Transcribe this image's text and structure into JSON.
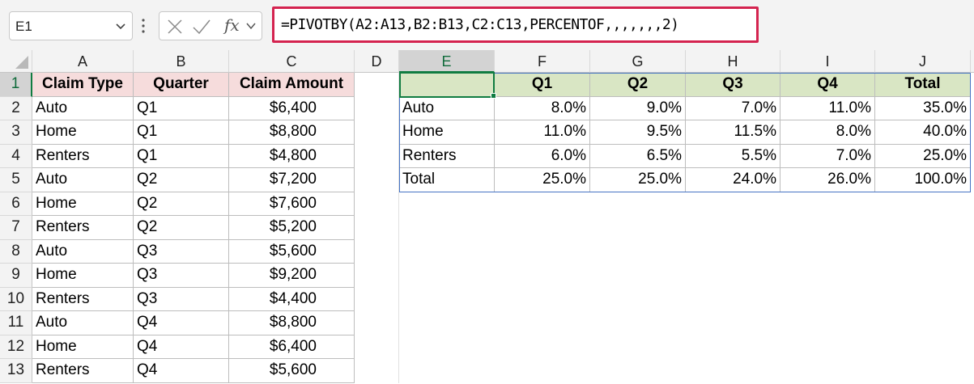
{
  "formula_bar": {
    "name_box": "E1",
    "fx_label": "fx",
    "formula": "=PIVOTBY(A2:A13,B2:B13,C2:C13,PERCENTOF,,,,,,,2)"
  },
  "columns": [
    "A",
    "B",
    "C",
    "D",
    "E",
    "F",
    "G",
    "H",
    "I",
    "J"
  ],
  "rows": [
    "1",
    "2",
    "3",
    "4",
    "5",
    "6",
    "7",
    "8",
    "9",
    "10",
    "11",
    "12",
    "13"
  ],
  "source_table": {
    "headers": [
      "Claim Type",
      "Quarter",
      "Claim Amount"
    ],
    "rows": [
      [
        "Auto",
        "Q1",
        "$6,400"
      ],
      [
        "Home",
        "Q1",
        "$8,800"
      ],
      [
        "Renters",
        "Q1",
        "$4,800"
      ],
      [
        "Auto",
        "Q2",
        "$7,200"
      ],
      [
        "Home",
        "Q2",
        "$7,600"
      ],
      [
        "Renters",
        "Q2",
        "$5,200"
      ],
      [
        "Auto",
        "Q3",
        "$5,600"
      ],
      [
        "Home",
        "Q3",
        "$9,200"
      ],
      [
        "Renters",
        "Q3",
        "$4,400"
      ],
      [
        "Auto",
        "Q4",
        "$8,800"
      ],
      [
        "Home",
        "Q4",
        "$6,400"
      ],
      [
        "Renters",
        "Q4",
        "$5,600"
      ]
    ]
  },
  "pivot_table": {
    "corner": "",
    "headers": [
      "Q1",
      "Q2",
      "Q3",
      "Q4",
      "Total"
    ],
    "rows": [
      {
        "label": "Auto",
        "values": [
          "8.0%",
          "9.0%",
          "7.0%",
          "11.0%",
          "35.0%"
        ]
      },
      {
        "label": "Home",
        "values": [
          "11.0%",
          "9.5%",
          "11.5%",
          "8.0%",
          "40.0%"
        ]
      },
      {
        "label": "Renters",
        "values": [
          "6.0%",
          "6.5%",
          "5.5%",
          "7.0%",
          "25.0%"
        ]
      },
      {
        "label": "Total",
        "values": [
          "25.0%",
          "25.0%",
          "24.0%",
          "26.0%",
          "100.0%"
        ]
      }
    ]
  },
  "colors": {
    "formula_highlight": "#d4234f",
    "source_header_bg": "#f6dcdc",
    "pivot_header_bg": "#d9e6c4",
    "selection": "#107c41",
    "pivot_border": "#4472c4"
  }
}
